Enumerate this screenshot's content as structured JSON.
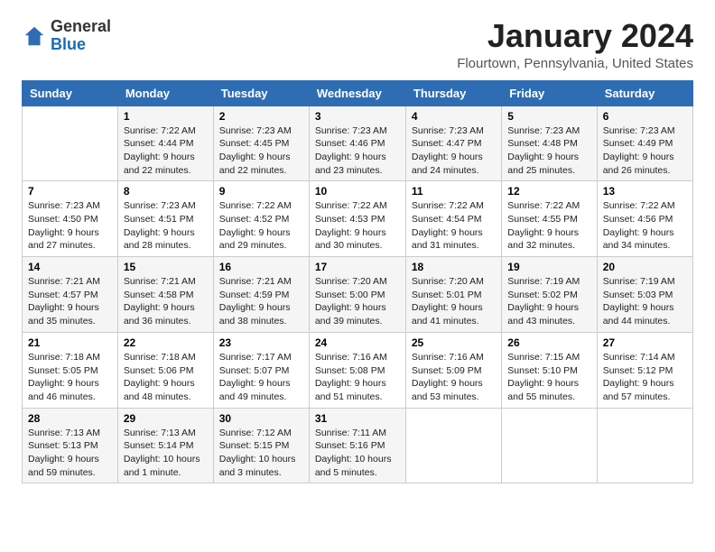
{
  "logo": {
    "general": "General",
    "blue": "Blue"
  },
  "title": "January 2024",
  "location": "Flourtown, Pennsylvania, United States",
  "days_header": [
    "Sunday",
    "Monday",
    "Tuesday",
    "Wednesday",
    "Thursday",
    "Friday",
    "Saturday"
  ],
  "weeks": [
    [
      {
        "day": "",
        "sunrise": "",
        "sunset": "",
        "daylight": ""
      },
      {
        "day": "1",
        "sunrise": "Sunrise: 7:22 AM",
        "sunset": "Sunset: 4:44 PM",
        "daylight": "Daylight: 9 hours and 22 minutes."
      },
      {
        "day": "2",
        "sunrise": "Sunrise: 7:23 AM",
        "sunset": "Sunset: 4:45 PM",
        "daylight": "Daylight: 9 hours and 22 minutes."
      },
      {
        "day": "3",
        "sunrise": "Sunrise: 7:23 AM",
        "sunset": "Sunset: 4:46 PM",
        "daylight": "Daylight: 9 hours and 23 minutes."
      },
      {
        "day": "4",
        "sunrise": "Sunrise: 7:23 AM",
        "sunset": "Sunset: 4:47 PM",
        "daylight": "Daylight: 9 hours and 24 minutes."
      },
      {
        "day": "5",
        "sunrise": "Sunrise: 7:23 AM",
        "sunset": "Sunset: 4:48 PM",
        "daylight": "Daylight: 9 hours and 25 minutes."
      },
      {
        "day": "6",
        "sunrise": "Sunrise: 7:23 AM",
        "sunset": "Sunset: 4:49 PM",
        "daylight": "Daylight: 9 hours and 26 minutes."
      }
    ],
    [
      {
        "day": "7",
        "sunrise": "Sunrise: 7:23 AM",
        "sunset": "Sunset: 4:50 PM",
        "daylight": "Daylight: 9 hours and 27 minutes."
      },
      {
        "day": "8",
        "sunrise": "Sunrise: 7:23 AM",
        "sunset": "Sunset: 4:51 PM",
        "daylight": "Daylight: 9 hours and 28 minutes."
      },
      {
        "day": "9",
        "sunrise": "Sunrise: 7:22 AM",
        "sunset": "Sunset: 4:52 PM",
        "daylight": "Daylight: 9 hours and 29 minutes."
      },
      {
        "day": "10",
        "sunrise": "Sunrise: 7:22 AM",
        "sunset": "Sunset: 4:53 PM",
        "daylight": "Daylight: 9 hours and 30 minutes."
      },
      {
        "day": "11",
        "sunrise": "Sunrise: 7:22 AM",
        "sunset": "Sunset: 4:54 PM",
        "daylight": "Daylight: 9 hours and 31 minutes."
      },
      {
        "day": "12",
        "sunrise": "Sunrise: 7:22 AM",
        "sunset": "Sunset: 4:55 PM",
        "daylight": "Daylight: 9 hours and 32 minutes."
      },
      {
        "day": "13",
        "sunrise": "Sunrise: 7:22 AM",
        "sunset": "Sunset: 4:56 PM",
        "daylight": "Daylight: 9 hours and 34 minutes."
      }
    ],
    [
      {
        "day": "14",
        "sunrise": "Sunrise: 7:21 AM",
        "sunset": "Sunset: 4:57 PM",
        "daylight": "Daylight: 9 hours and 35 minutes."
      },
      {
        "day": "15",
        "sunrise": "Sunrise: 7:21 AM",
        "sunset": "Sunset: 4:58 PM",
        "daylight": "Daylight: 9 hours and 36 minutes."
      },
      {
        "day": "16",
        "sunrise": "Sunrise: 7:21 AM",
        "sunset": "Sunset: 4:59 PM",
        "daylight": "Daylight: 9 hours and 38 minutes."
      },
      {
        "day": "17",
        "sunrise": "Sunrise: 7:20 AM",
        "sunset": "Sunset: 5:00 PM",
        "daylight": "Daylight: 9 hours and 39 minutes."
      },
      {
        "day": "18",
        "sunrise": "Sunrise: 7:20 AM",
        "sunset": "Sunset: 5:01 PM",
        "daylight": "Daylight: 9 hours and 41 minutes."
      },
      {
        "day": "19",
        "sunrise": "Sunrise: 7:19 AM",
        "sunset": "Sunset: 5:02 PM",
        "daylight": "Daylight: 9 hours and 43 minutes."
      },
      {
        "day": "20",
        "sunrise": "Sunrise: 7:19 AM",
        "sunset": "Sunset: 5:03 PM",
        "daylight": "Daylight: 9 hours and 44 minutes."
      }
    ],
    [
      {
        "day": "21",
        "sunrise": "Sunrise: 7:18 AM",
        "sunset": "Sunset: 5:05 PM",
        "daylight": "Daylight: 9 hours and 46 minutes."
      },
      {
        "day": "22",
        "sunrise": "Sunrise: 7:18 AM",
        "sunset": "Sunset: 5:06 PM",
        "daylight": "Daylight: 9 hours and 48 minutes."
      },
      {
        "day": "23",
        "sunrise": "Sunrise: 7:17 AM",
        "sunset": "Sunset: 5:07 PM",
        "daylight": "Daylight: 9 hours and 49 minutes."
      },
      {
        "day": "24",
        "sunrise": "Sunrise: 7:16 AM",
        "sunset": "Sunset: 5:08 PM",
        "daylight": "Daylight: 9 hours and 51 minutes."
      },
      {
        "day": "25",
        "sunrise": "Sunrise: 7:16 AM",
        "sunset": "Sunset: 5:09 PM",
        "daylight": "Daylight: 9 hours and 53 minutes."
      },
      {
        "day": "26",
        "sunrise": "Sunrise: 7:15 AM",
        "sunset": "Sunset: 5:10 PM",
        "daylight": "Daylight: 9 hours and 55 minutes."
      },
      {
        "day": "27",
        "sunrise": "Sunrise: 7:14 AM",
        "sunset": "Sunset: 5:12 PM",
        "daylight": "Daylight: 9 hours and 57 minutes."
      }
    ],
    [
      {
        "day": "28",
        "sunrise": "Sunrise: 7:13 AM",
        "sunset": "Sunset: 5:13 PM",
        "daylight": "Daylight: 9 hours and 59 minutes."
      },
      {
        "day": "29",
        "sunrise": "Sunrise: 7:13 AM",
        "sunset": "Sunset: 5:14 PM",
        "daylight": "Daylight: 10 hours and 1 minute."
      },
      {
        "day": "30",
        "sunrise": "Sunrise: 7:12 AM",
        "sunset": "Sunset: 5:15 PM",
        "daylight": "Daylight: 10 hours and 3 minutes."
      },
      {
        "day": "31",
        "sunrise": "Sunrise: 7:11 AM",
        "sunset": "Sunset: 5:16 PM",
        "daylight": "Daylight: 10 hours and 5 minutes."
      },
      {
        "day": "",
        "sunrise": "",
        "sunset": "",
        "daylight": ""
      },
      {
        "day": "",
        "sunrise": "",
        "sunset": "",
        "daylight": ""
      },
      {
        "day": "",
        "sunrise": "",
        "sunset": "",
        "daylight": ""
      }
    ]
  ]
}
